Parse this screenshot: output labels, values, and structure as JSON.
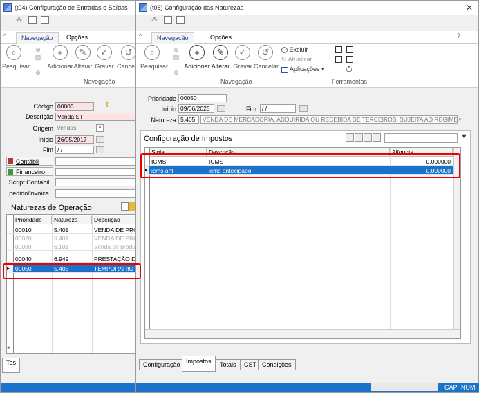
{
  "left_window": {
    "title": "(t04)  Configuração de Entradas e Saídas",
    "tabs": [
      "Navegação",
      "Opções"
    ],
    "ribbon_buttons": [
      "Pesquisar",
      "Adicionar",
      "Alterar",
      "Gravar",
      "Cancelar"
    ],
    "ribbon_group": "Navegação",
    "form": {
      "codigo_label": "Código",
      "codigo": "00003",
      "descricao_label": "Descrição",
      "descricao": "Venda ST",
      "origem_label": "Origem",
      "origem": "Vendas",
      "inicio_label": "Início",
      "inicio": "26/05/2017",
      "fim_label": "Fim",
      "fim": "/ /",
      "contabil_label": "Contábil",
      "financeiro_label": "Financeiro",
      "script_label": "Script Contábil",
      "pedido_label": "pedido/invoice"
    },
    "naturezas_title": "Naturezas de Operação",
    "columns": [
      "Prioridade",
      "Natureza",
      "Descrição"
    ],
    "rows": [
      {
        "prioridade": "00010",
        "natureza": "5.401",
        "descricao": "VENDA DE PROD",
        "style": "normal"
      },
      {
        "prioridade": "00020",
        "natureza": "6.401",
        "descricao": "VENDA DE PROD",
        "style": "muted"
      },
      {
        "prioridade": "00030",
        "natureza": "6.101",
        "descricao": "Venda de produ",
        "style": "muted"
      },
      {
        "prioridade": "00040",
        "natureza": "6.949",
        "descricao": "PRESTAÇÃO DE",
        "style": "normal"
      },
      {
        "prioridade": "00050",
        "natureza": "5.405",
        "descricao": "TEMPORARIO",
        "style": "selected"
      }
    ],
    "bottom_tab": "Tes"
  },
  "right_window": {
    "title": "(t06)  Configuração das Naturezas",
    "tabs": [
      "Navegação",
      "Opções"
    ],
    "ribbon_buttons": [
      "Pesquisar",
      "Adicionar",
      "Alterar",
      "Gravar",
      "Cancelar"
    ],
    "small_buttons": [
      "Excluir",
      "Atualizar",
      "Aplicações"
    ],
    "ribbon_groups": [
      "Navegação",
      "Ferramentas"
    ],
    "form": {
      "prioridade_label": "Prioridade",
      "prioridade": "00050",
      "inicio_label": "Início",
      "inicio": "09/06/2025",
      "fim_label": "Fim",
      "fim": "/ /",
      "natureza_label": "Natureza",
      "natureza_code": "5.405",
      "natureza_desc": "VENDA DE MERCADORIA, ADQUIRIDA OU RECEBIDA DE TERCEIROS, SUJEITA AO REGIME DE SU"
    },
    "impostos_title": "Configuração de Impostos",
    "columns": [
      "Sigla",
      "Descrição",
      "Alíquota"
    ],
    "rows": [
      {
        "sigla": "ICMS",
        "descricao": "ICMS",
        "aliquota": "0,000000",
        "selected": false
      },
      {
        "sigla": "icms ant",
        "descricao": "icms antecipado",
        "aliquota": "0,000000",
        "selected": true
      }
    ],
    "bottom_tabs": [
      "Configuração",
      "Impostos",
      "Totais",
      "CST",
      "Condições"
    ],
    "status": [
      "CAP",
      "NUM"
    ]
  },
  "colors": {
    "accent": "#1a73c8",
    "highlight": "#e00000",
    "pink_field": "#fde2e6"
  }
}
